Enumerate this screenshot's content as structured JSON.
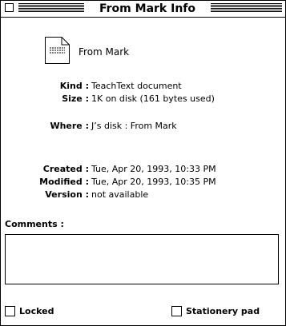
{
  "window": {
    "title": "From Mark Info"
  },
  "file": {
    "name": "From Mark",
    "icon": "text-document-icon"
  },
  "info": {
    "kind_label": "Kind :",
    "kind_value": "TeachText document",
    "size_label": "Size :",
    "size_value": "1K on disk (161 bytes used)",
    "where_label": "Where :",
    "where_value": "J’s disk : From Mark",
    "created_label": "Created :",
    "created_value": "Tue, Apr 20, 1993, 10:33 PM",
    "modified_label": "Modified :",
    "modified_value": "Tue, Apr 20, 1993, 10:35 PM",
    "version_label": "Version :",
    "version_value": "not available"
  },
  "comments": {
    "label": "Comments :",
    "value": ""
  },
  "options": {
    "locked_label": "Locked",
    "locked_checked": false,
    "stationery_label": "Stationery pad",
    "stationery_checked": false
  }
}
